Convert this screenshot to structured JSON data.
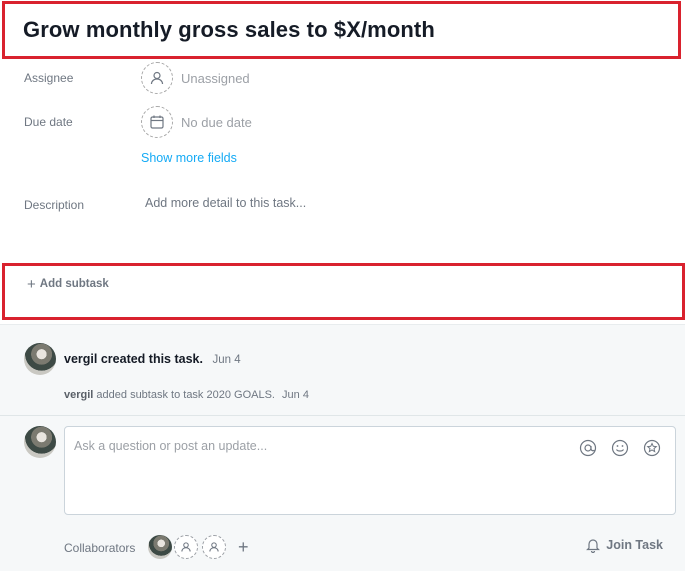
{
  "task": {
    "title": "Grow monthly gross sales to $X/month"
  },
  "fields": {
    "assignee": {
      "label": "Assignee",
      "value": "Unassigned",
      "icon": "person-icon"
    },
    "due_date": {
      "label": "Due date",
      "value": "No due date",
      "icon": "calendar-icon"
    },
    "show_more": "Show more fields",
    "description": {
      "label": "Description",
      "placeholder": "Add more detail to this task..."
    }
  },
  "subtask": {
    "label": "Add subtask",
    "icon": "plus-icon"
  },
  "feed": {
    "created": {
      "actor": "vergil",
      "action": "created this task.",
      "time": "Jun 4"
    },
    "added": {
      "actor": "vergil",
      "action": "added subtask to task 2020 GOALS.",
      "time": "Jun 4"
    }
  },
  "composer": {
    "placeholder": "Ask a question or post an update...",
    "icons": [
      "at-mention-icon",
      "emoji-icon",
      "star-icon"
    ]
  },
  "collaborators": {
    "label": "Collaborators",
    "join_label": "Join Task"
  },
  "colors": {
    "accent": "#14aaf5",
    "highlight": "#d9222e",
    "muted": "#6f7782"
  }
}
